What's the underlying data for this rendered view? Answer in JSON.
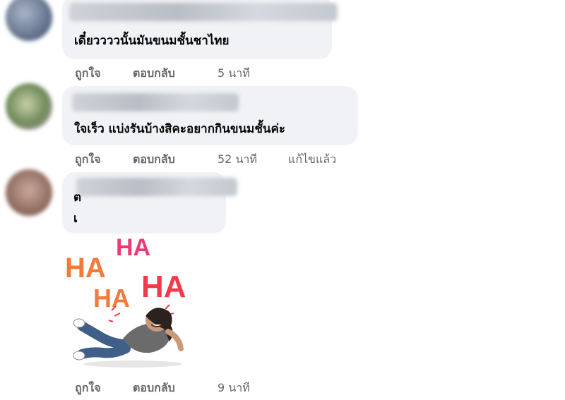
{
  "comments": [
    {
      "text": "เดี๋ยววววนั้นมันขนมชั้นชาไทย",
      "actions": {
        "like": "ถูกใจ",
        "reply": "ตอบกลับ",
        "time": "5 นาที"
      }
    },
    {
      "text": "ใจเร็ว แบ่งรันบ้างสิคะอยากกินขนมชั้นค่ะ",
      "actions": {
        "like": "ถูกใจ",
        "reply": "ตอบกลับ",
        "time": "52 นาที",
        "edited": "แก้ไขแล้ว"
      }
    },
    {
      "text_line1": "ต",
      "text_line2": "เ",
      "sticker": {
        "words": [
          "HA",
          "HA",
          "HA",
          "HA"
        ]
      },
      "actions": {
        "like": "ถูกใจ",
        "reply": "ตอบกลับ",
        "time": "9 นาที"
      }
    }
  ],
  "colors": {
    "bubble": "#f0f2f5",
    "action_text": "#65676b",
    "ha_pink": "#ec3a74",
    "ha_orange": "#f47a3a",
    "ha_red": "#ef3b4b"
  }
}
